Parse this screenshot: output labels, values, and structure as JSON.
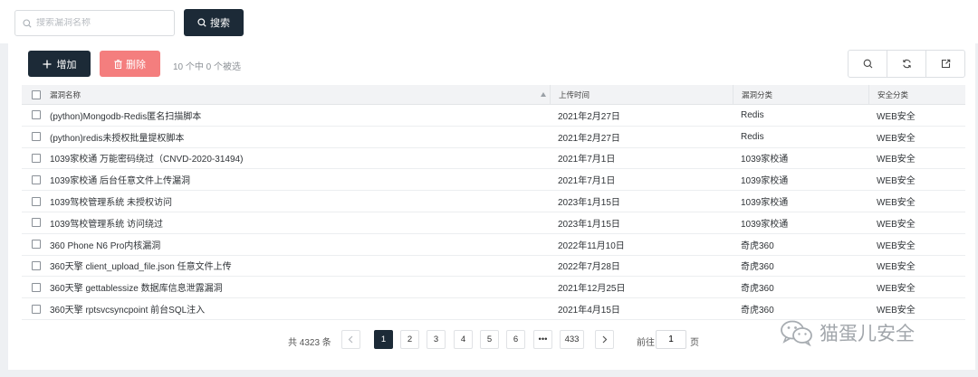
{
  "search": {
    "placeholder": "搜索漏洞名称",
    "button_label": "搜索"
  },
  "toolbar": {
    "add_label": "增加",
    "delete_label": "删除",
    "selection_text": "10 个中 0 个被选"
  },
  "table": {
    "headers": [
      "漏洞名称",
      "上传时间",
      "漏洞分类",
      "安全分类"
    ],
    "rows": [
      {
        "name": "(python)Mongodb-Redis匿名扫描脚本",
        "time": "2021年2月27日",
        "category": "Redis",
        "security": "WEB安全"
      },
      {
        "name": "(python)redis未授权批量提权脚本",
        "time": "2021年2月27日",
        "category": "Redis",
        "security": "WEB安全"
      },
      {
        "name": "1039家校通 万能密码绕过（CNVD-2020-31494)",
        "time": "2021年7月1日",
        "category": "1039家校通",
        "security": "WEB安全"
      },
      {
        "name": "1039家校通 后台任意文件上传漏洞",
        "time": "2021年7月1日",
        "category": "1039家校通",
        "security": "WEB安全"
      },
      {
        "name": "1039驾校管理系统 未授权访问",
        "time": "2023年1月15日",
        "category": "1039家校通",
        "security": "WEB安全"
      },
      {
        "name": "1039驾校管理系统 访问绕过",
        "time": "2023年1月15日",
        "category": "1039家校通",
        "security": "WEB安全"
      },
      {
        "name": "360 Phone N6 Pro内核漏洞",
        "time": "2022年11月10日",
        "category": "奇虎360",
        "security": "WEB安全"
      },
      {
        "name": "360天擎 client_upload_file.json 任意文件上传",
        "time": "2022年7月28日",
        "category": "奇虎360",
        "security": "WEB安全"
      },
      {
        "name": "360天擎 gettablessize 数据库信息泄露漏洞",
        "time": "2021年12月25日",
        "category": "奇虎360",
        "security": "WEB安全"
      },
      {
        "name": "360天擎 rptsvcsyncpoint 前台SQL注入",
        "time": "2021年4月15日",
        "category": "奇虎360",
        "security": "WEB安全"
      }
    ]
  },
  "pagination": {
    "total_text": "共 4323 条",
    "pages": [
      "1",
      "2",
      "3",
      "4",
      "5",
      "6",
      "•••",
      "433"
    ],
    "current": "1",
    "goto_label": "前往",
    "goto_value": "1",
    "goto_suffix": "页"
  },
  "watermark": {
    "text": "猫蛋儿安全"
  },
  "icons": {
    "search": "search-icon",
    "add": "plus-icon",
    "delete": "trash-icon",
    "tool_search": "search-icon",
    "tool_refresh": "refresh-icon",
    "tool_export": "export-icon",
    "prev": "chevron-left-icon",
    "next": "chevron-right-icon",
    "sort": "sort-up-icon",
    "watermark": "wechat-icon"
  },
  "colors": {
    "primary": "#1c2a37",
    "danger": "#f47e7e",
    "background": "#eef0f3"
  }
}
